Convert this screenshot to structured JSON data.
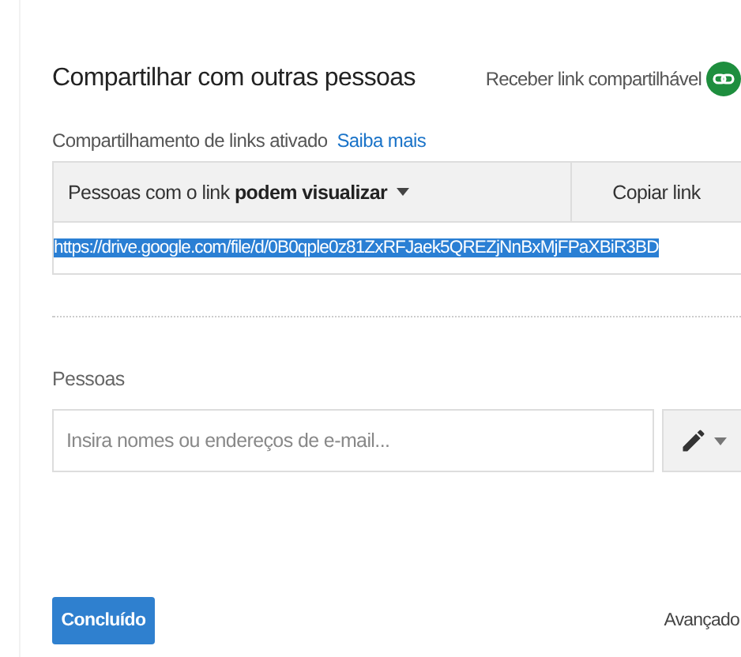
{
  "dialog": {
    "title": "Compartilhar com outras pessoas",
    "get_link": {
      "label": "Receber link compartilhável",
      "on": true
    },
    "link_sharing": {
      "status": "Compartilhamento de links ativado",
      "learn_more": "Saiba mais",
      "access": "Pessoas com o link **podem visualizar**",
      "copy_button": "Copiar link",
      "url": {
        "value": "https://drive.google.com/file/d/0B0qple0z81ZxRFJaek5QREZjNnBxMjFPaXBiR3BD",
        "selected": true
      }
    },
    "people": {
      "label": "Pessoas",
      "placeholder": "Insira nomes ou endereços de e-mail..."
    },
    "done_button": "Concluído",
    "advanced": "Avançado"
  }
}
